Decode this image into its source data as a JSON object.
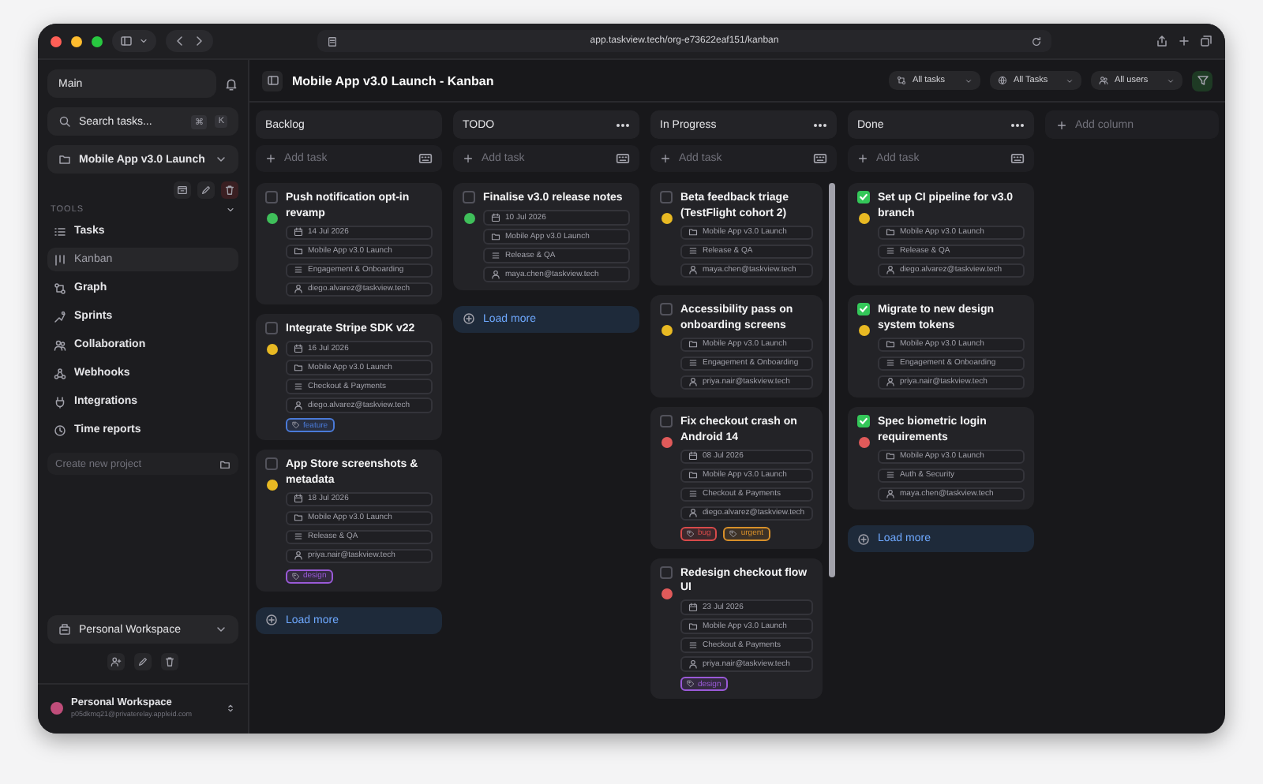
{
  "browser": {
    "url": "app.taskview.tech/org-e73622eaf151/kanban"
  },
  "sidebar": {
    "workspace_select": "Main",
    "search": {
      "placeholder": "Search tasks...",
      "shortcut": [
        "⌘",
        "K"
      ]
    },
    "project_select": "Mobile App v3.0 Launch",
    "section_label": "TOOLS",
    "items": [
      {
        "label": "Tasks",
        "selected": false
      },
      {
        "label": "Kanban",
        "selected": true
      },
      {
        "label": "Graph",
        "selected": false
      },
      {
        "label": "Sprints",
        "selected": false
      },
      {
        "label": "Collaboration",
        "selected": false
      },
      {
        "label": "Webhooks",
        "selected": false
      },
      {
        "label": "Integrations",
        "selected": false
      },
      {
        "label": "Time reports",
        "selected": false
      }
    ],
    "new_project": {
      "placeholder": "Create new project"
    },
    "bottom_select": "Personal Workspace",
    "account": {
      "name": "Personal Workspace",
      "email": "p05dkmq21@privaterelay.appleid.com"
    }
  },
  "header": {
    "title": "Mobile App v3.0 Launch - Kanban",
    "filters": [
      "All tasks",
      "All Tasks",
      "All users"
    ]
  },
  "board": {
    "add_column": "Add column",
    "columns": [
      {
        "name": "Backlog",
        "menu": false,
        "add_task": "Add task",
        "load_more": "Load more",
        "cards": [
          {
            "title": "Push notification opt-in revamp",
            "checked": false,
            "color": "#3fbf5a",
            "meta": [
              {
                "kind": "date",
                "text": "14 Jul 2026"
              },
              {
                "kind": "project",
                "text": "Mobile App v3.0 Launch"
              },
              {
                "kind": "category",
                "text": "Engagement & Onboarding"
              },
              {
                "kind": "user",
                "text": "diego.alvarez@taskview.tech"
              }
            ]
          },
          {
            "title": "Integrate Stripe SDK v22",
            "checked": false,
            "color": "#e8b923",
            "meta": [
              {
                "kind": "date",
                "text": "16 Jul 2026"
              },
              {
                "kind": "project",
                "text": "Mobile App v3.0 Launch"
              },
              {
                "kind": "category",
                "text": "Checkout & Payments"
              },
              {
                "kind": "user",
                "text": "diego.alvarez@taskview.tech"
              }
            ],
            "tags": [
              {
                "text": "feature",
                "color": "#4a7ad8"
              }
            ]
          },
          {
            "title": "App Store screenshots & metadata",
            "checked": false,
            "color": "#e8b923",
            "meta": [
              {
                "kind": "date",
                "text": "18 Jul 2026"
              },
              {
                "kind": "project",
                "text": "Mobile App v3.0 Launch"
              },
              {
                "kind": "category",
                "text": "Release & QA"
              },
              {
                "kind": "user",
                "text": "priya.nair@taskview.tech"
              }
            ],
            "tags": [
              {
                "text": "design",
                "color": "#9a5ad8"
              }
            ]
          }
        ]
      },
      {
        "name": "TODO",
        "menu": true,
        "add_task": "Add task",
        "load_more": "Load more",
        "cards": [
          {
            "title": "Finalise v3.0 release notes",
            "checked": false,
            "color": "#3fbf5a",
            "meta": [
              {
                "kind": "date",
                "text": "10 Jul 2026"
              },
              {
                "kind": "project",
                "text": "Mobile App v3.0 Launch"
              },
              {
                "kind": "category",
                "text": "Release & QA"
              },
              {
                "kind": "user",
                "text": "maya.chen@taskview.tech"
              }
            ]
          }
        ]
      },
      {
        "name": "In Progress",
        "menu": true,
        "add_task": "Add task",
        "cards": [
          {
            "title": "Beta feedback triage (TestFlight cohort 2)",
            "checked": false,
            "color": "#e8b923",
            "meta": [
              {
                "kind": "project",
                "text": "Mobile App v3.0 Launch"
              },
              {
                "kind": "category",
                "text": "Release & QA"
              },
              {
                "kind": "user",
                "text": "maya.chen@taskview.tech"
              }
            ]
          },
          {
            "title": "Accessibility pass on onboarding screens",
            "checked": false,
            "color": "#e8b923",
            "meta": [
              {
                "kind": "project",
                "text": "Mobile App v3.0 Launch"
              },
              {
                "kind": "category",
                "text": "Engagement & Onboarding"
              },
              {
                "kind": "user",
                "text": "priya.nair@taskview.tech"
              }
            ]
          },
          {
            "title": "Fix checkout crash on Android 14",
            "checked": false,
            "color": "#e05a5a",
            "meta": [
              {
                "kind": "date",
                "text": "08 Jul 2026"
              },
              {
                "kind": "project",
                "text": "Mobile App v3.0 Launch"
              },
              {
                "kind": "category",
                "text": "Checkout & Payments"
              },
              {
                "kind": "user",
                "text": "diego.alvarez@taskview.tech"
              }
            ],
            "tags": [
              {
                "text": "bug",
                "color": "#d84a4a"
              },
              {
                "text": "urgent",
                "color": "#d8902a"
              }
            ]
          },
          {
            "title": "Redesign checkout flow UI",
            "checked": false,
            "color": "#e05a5a",
            "meta": [
              {
                "kind": "date",
                "text": "23 Jul 2026"
              },
              {
                "kind": "project",
                "text": "Mobile App v3.0 Launch"
              },
              {
                "kind": "category",
                "text": "Checkout & Payments"
              },
              {
                "kind": "user",
                "text": "priya.nair@taskview.tech"
              }
            ],
            "tags": [
              {
                "text": "design",
                "color": "#9a5ad8"
              }
            ]
          }
        ]
      },
      {
        "name": "Done",
        "menu": true,
        "add_task": "Add task",
        "load_more": "Load more",
        "cards": [
          {
            "title": "Set up CI pipeline for v3.0 branch",
            "checked": true,
            "color": "#e8b923",
            "meta": [
              {
                "kind": "project",
                "text": "Mobile App v3.0 Launch"
              },
              {
                "kind": "category",
                "text": "Release & QA"
              },
              {
                "kind": "user",
                "text": "diego.alvarez@taskview.tech"
              }
            ]
          },
          {
            "title": "Migrate to new design system tokens",
            "checked": true,
            "color": "#e8b923",
            "meta": [
              {
                "kind": "project",
                "text": "Mobile App v3.0 Launch"
              },
              {
                "kind": "category",
                "text": "Engagement & Onboarding"
              },
              {
                "kind": "user",
                "text": "priya.nair@taskview.tech"
              }
            ]
          },
          {
            "title": "Spec biometric login requirements",
            "checked": true,
            "color": "#e05a5a",
            "meta": [
              {
                "kind": "project",
                "text": "Mobile App v3.0 Launch"
              },
              {
                "kind": "category",
                "text": "Auth & Security"
              },
              {
                "kind": "user",
                "text": "maya.chen@taskview.tech"
              }
            ]
          }
        ]
      }
    ]
  }
}
